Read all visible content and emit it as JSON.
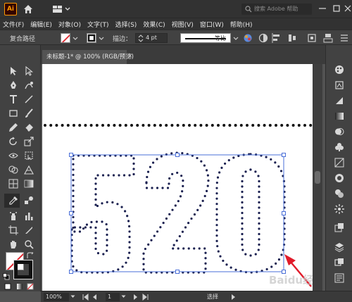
{
  "app": {
    "logo": "Ai"
  },
  "search": {
    "placeholder": "搜索 Adobe 帮助"
  },
  "menu": {
    "items": [
      "文件(F)",
      "编辑(E)",
      "对象(O)",
      "文字(T)",
      "选择(S)",
      "效果(C)",
      "视图(V)",
      "窗口(W)",
      "帮助(H)"
    ]
  },
  "control": {
    "object_type": "复合路径",
    "stroke_label": "描边：",
    "stroke_value": "4 pt",
    "ratio_label": "等比"
  },
  "document": {
    "tab_title": "未标题-1* @ 100% (RGB/预览)",
    "close": "×"
  },
  "artwork": {
    "text": "520"
  },
  "status": {
    "zoom": "100%",
    "artboard_index": "1",
    "tool_label": "选择"
  },
  "watermark": "Baidu经验",
  "colors": {
    "ui_dark": "#323232",
    "ui_panel": "#424242",
    "canvas": "#535353",
    "selection": "#4a6fd8",
    "dot": "#1a2050",
    "arrow": "#e11b2a",
    "brand_orange": "#ff9a00"
  },
  "icons": [
    "home-icon",
    "workspace-icon",
    "search-icon",
    "minimize-icon",
    "maximize-icon",
    "close-icon",
    "selection-tool-icon",
    "direct-selection-tool-icon",
    "pen-tool-icon",
    "curvature-tool-icon",
    "type-tool-icon",
    "line-tool-icon",
    "rectangle-tool-icon",
    "paintbrush-tool-icon",
    "pencil-tool-icon",
    "eraser-tool-icon",
    "rotate-tool-icon",
    "scale-tool-icon",
    "width-tool-icon",
    "free-transform-tool-icon",
    "shape-builder-tool-icon",
    "perspective-grid-tool-icon",
    "mesh-tool-icon",
    "gradient-tool-icon",
    "eyedropper-tool-icon",
    "blend-tool-icon",
    "symbol-sprayer-tool-icon",
    "column-graph-tool-icon",
    "artboard-tool-icon",
    "slice-tool-icon",
    "hand-tool-icon",
    "zoom-tool-icon",
    "fill-stroke-icon",
    "swap-icon",
    "default-colors-icon",
    "color-mode-icons",
    "color-panel-icon",
    "libraries-icon",
    "stroke-panel-icon",
    "gradient-panel-icon",
    "transparency-panel-icon",
    "symbols-panel-icon",
    "graphic-styles-icon",
    "appearance-panel-icon",
    "brushes-panel-icon",
    "swatches-panel-icon",
    "layers-panel-icon",
    "artboards-panel-icon",
    "asset-export-icon"
  ]
}
